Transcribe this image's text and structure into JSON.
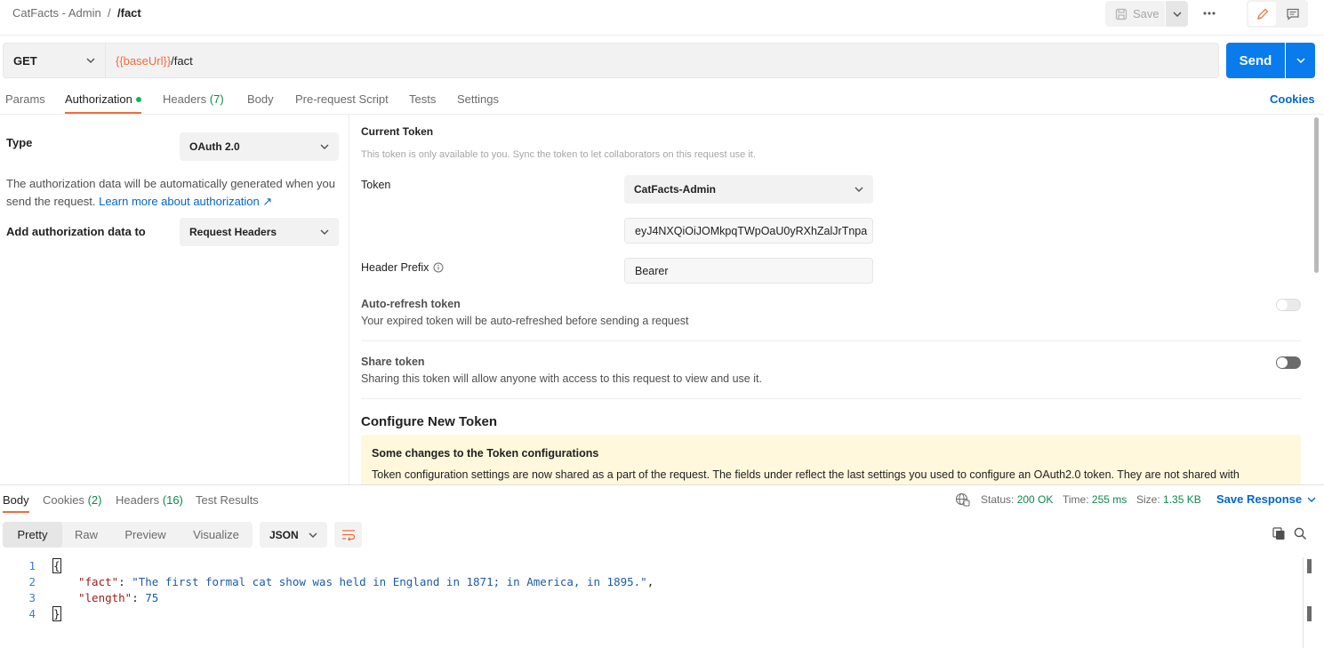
{
  "breadcrumb": {
    "collection": "CatFacts - Admin",
    "separator": "/",
    "request": "/fact"
  },
  "toolbar": {
    "save_label": "Save"
  },
  "request": {
    "method": "GET",
    "url_variable": "{{baseUrl}}",
    "url_path": "/fact",
    "send_label": "Send"
  },
  "tabs": {
    "params": "Params",
    "authorization": "Authorization",
    "headers": "Headers",
    "headers_count": "(7)",
    "body": "Body",
    "prerequest": "Pre-request Script",
    "tests": "Tests",
    "settings": "Settings",
    "cookies": "Cookies"
  },
  "auth": {
    "type_label": "Type",
    "type_value": "OAuth 2.0",
    "help_text": "The authorization data will be automatically generated when you send the request.",
    "help_link": "Learn more about authorization ↗",
    "add_to_label": "Add authorization data to",
    "add_to_value": "Request Headers"
  },
  "current_token": {
    "title": "Current Token",
    "note": "This token is only available to you. Sync the token to let collaborators on this request use it.",
    "token_label": "Token",
    "token_select": "CatFacts-Admin",
    "token_value": "eyJ4NXQiOiJOMkpqTWpOaU0yRXhZalJrTnpa",
    "header_prefix_label": "Header Prefix",
    "header_prefix_value": "Bearer",
    "auto_refresh_title": "Auto-refresh token",
    "auto_refresh_desc": "Your expired token will be auto-refreshed before sending a request",
    "share_title": "Share token",
    "share_desc": "Sharing this token will allow anyone with access to this request to view and use it."
  },
  "configure": {
    "title": "Configure New Token",
    "banner_title": "Some changes to the Token configurations",
    "banner_text": "Token configuration settings are now shared as a part of the request. The fields under reflect the last settings you used to configure an OAuth2.0 token. They are not shared with"
  },
  "response": {
    "tabs": {
      "body": "Body",
      "cookies": "Cookies",
      "cookies_count": "(2)",
      "headers": "Headers",
      "headers_count": "(16)",
      "tests": "Test Results"
    },
    "status_label": "Status:",
    "status_value": "200 OK",
    "time_label": "Time:",
    "time_value": "255 ms",
    "size_label": "Size:",
    "size_value": "1.35 KB",
    "save_label": "Save Response",
    "views": {
      "pretty": "Pretty",
      "raw": "Raw",
      "preview": "Preview",
      "visualize": "Visualize"
    },
    "format": "JSON",
    "code": {
      "line_numbers": [
        "1",
        "2",
        "3",
        "4"
      ],
      "open_brace": "{",
      "close_brace": "}",
      "fact_key": "\"fact\"",
      "fact_value": "\"The first formal cat show was held in England in 1871; in America, in 1895.\"",
      "length_key": "\"length\"",
      "length_value": "75"
    }
  },
  "colors": {
    "accent": "#f26b3a",
    "primary": "#097bed",
    "link": "#0265d2",
    "success": "#0c8a4a"
  }
}
